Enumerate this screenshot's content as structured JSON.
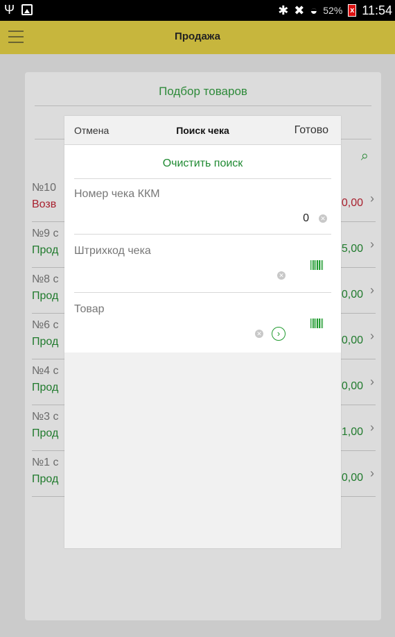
{
  "status_bar": {
    "battery_percent": "52%",
    "time": "11:54",
    "battery_icon_text": "x",
    "icons": [
      "usb-icon",
      "gallery-icon",
      "bluetooth-icon",
      "mute-icon",
      "wifi-icon",
      "battery-icon"
    ]
  },
  "header": {
    "title": "Продажа",
    "accent_color": "#c7b63d"
  },
  "card": {
    "title": "Подбор товаров",
    "rows": [
      {
        "number": "№10",
        "type": "Возв",
        "amount": ",0,00",
        "kind": "return"
      },
      {
        "number": "№9 с",
        "type": "Прод",
        "amount": "5,00",
        "kind": "sale"
      },
      {
        "number": "№8 с",
        "type": "Прод",
        "amount": ",0,00",
        "kind": "sale"
      },
      {
        "number": "№6 с",
        "type": "Прод",
        "amount": ",0,00",
        "kind": "sale"
      },
      {
        "number": "№4 с",
        "type": "Прод",
        "amount": ",0,00",
        "kind": "sale"
      },
      {
        "number": "№3 с",
        "type": "Прод",
        "amount": "1,00",
        "kind": "sale"
      },
      {
        "number": "№1 с",
        "type": "Прод",
        "amount": ",0,00",
        "kind": "sale"
      }
    ]
  },
  "dialog": {
    "cancel_label": "Отмена",
    "title": "Поиск чека",
    "done_label": "Готово",
    "clear_search_label": "Очистить поиск",
    "fields": {
      "receipt_number": {
        "label": "Номер чека ККМ",
        "value": "0"
      },
      "receipt_barcode": {
        "label": "Штрихкод чека",
        "value": ""
      },
      "product": {
        "label": "Товар",
        "value": ""
      }
    },
    "link_color": "#1f8a32"
  }
}
